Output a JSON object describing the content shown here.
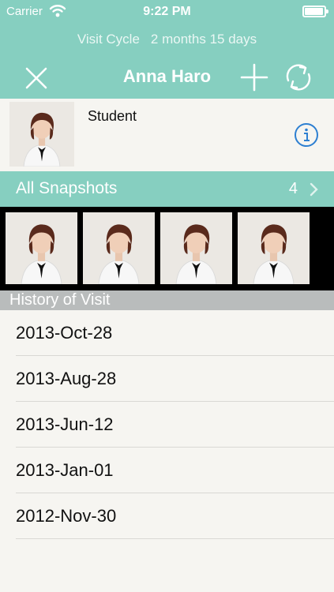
{
  "status_bar": {
    "carrier": "Carrier",
    "time": "9:22 PM"
  },
  "visit_cycle": {
    "label": "Visit Cycle",
    "value": "2 months 15 days"
  },
  "nav": {
    "title": "Anna Haro",
    "close_icon": "close-icon",
    "add_icon": "plus-icon",
    "sync_icon": "sync-icon"
  },
  "profile": {
    "occupation": "Student",
    "info_icon": "info-icon"
  },
  "snapshots": {
    "label": "All Snapshots",
    "count": "4"
  },
  "history": {
    "header": "History of Visit",
    "dates": [
      "2013-Oct-28",
      "2013-Aug-28",
      "2013-Jun-12",
      "2013-Jan-01",
      "2012-Nov-30",
      ""
    ]
  },
  "colors": {
    "accent": "#86cfc0",
    "section_gray": "#b9bcbc",
    "info_blue": "#2d7fd1",
    "background": "#f6f5f1"
  }
}
